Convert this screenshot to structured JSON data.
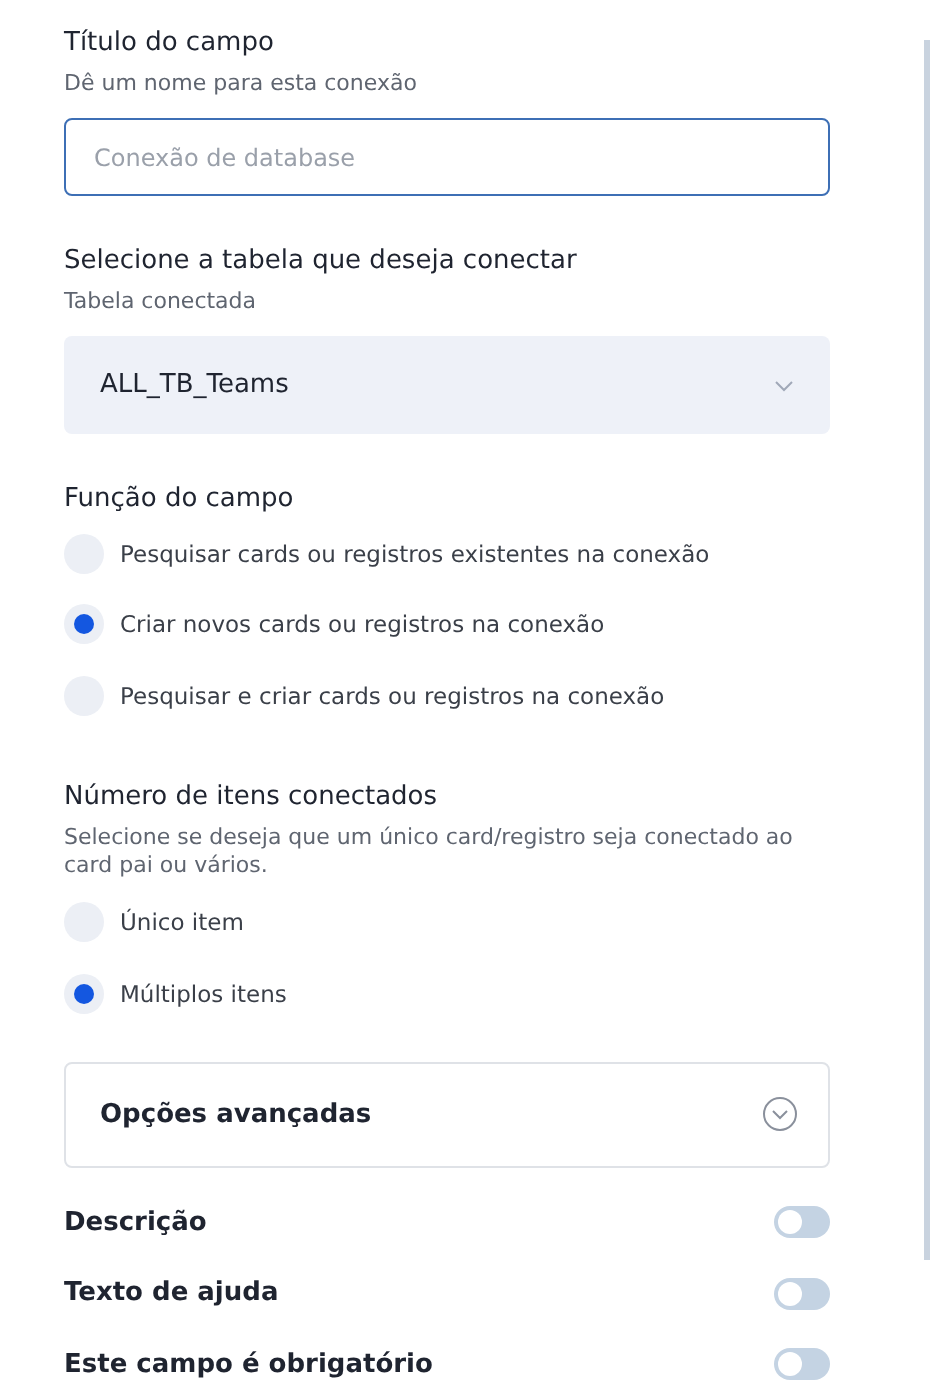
{
  "title_field": {
    "label": "Título do campo",
    "hint": "Dê um nome para esta conexão",
    "placeholder": "Conexão de database"
  },
  "table_select": {
    "label": "Selecione a tabela que deseja conectar",
    "hint": "Tabela conectada",
    "value": "ALL_TB_Teams"
  },
  "field_function": {
    "label": "Função do campo",
    "options": [
      {
        "label": "Pesquisar cards ou registros existentes na conexão",
        "selected": false
      },
      {
        "label": "Criar novos cards ou registros na conexão",
        "selected": true
      },
      {
        "label": "Pesquisar e criar cards ou registros na conexão",
        "selected": false
      }
    ]
  },
  "item_count": {
    "label": "Número de itens conectados",
    "hint": "Selecione se deseja que um único card/registro seja conectado ao card pai ou vários.",
    "options": [
      {
        "label": "Único item",
        "selected": false
      },
      {
        "label": "Múltiplos itens",
        "selected": true
      }
    ]
  },
  "advanced": {
    "label": "Opções avançadas",
    "expanded": false
  },
  "toggles": [
    {
      "label": "Descrição",
      "on": false
    },
    {
      "label": "Texto de ajuda",
      "on": false
    },
    {
      "label": "Este campo é obrigatório",
      "on": false
    }
  ]
}
